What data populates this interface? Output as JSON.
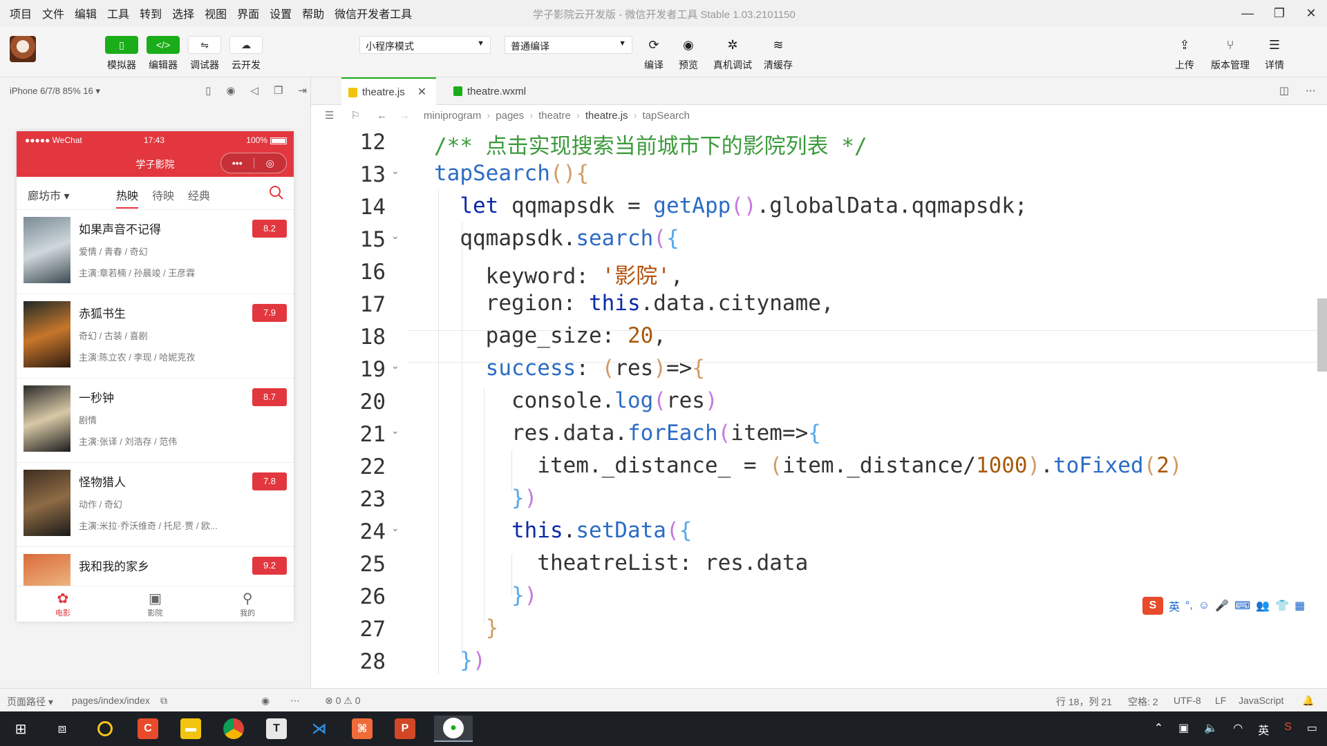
{
  "menu": [
    "项目",
    "文件",
    "编辑",
    "工具",
    "转到",
    "选择",
    "视图",
    "界面",
    "设置",
    "帮助",
    "微信开发者工具"
  ],
  "window_title": "学子影院云开发版 - 微信开发者工具 Stable 1.03.2101150",
  "toolbar": {
    "simulator": "模拟器",
    "editor": "编辑器",
    "debugger": "调试器",
    "cloud": "云开发",
    "mode_select": "小程序模式",
    "compile_select": "普通编译",
    "compile": "编译",
    "preview": "预览",
    "real_debug": "真机调试",
    "clear_cache": "清缓存",
    "upload": "上传",
    "version": "版本管理",
    "details": "详情"
  },
  "simulator": {
    "device": "iPhone 6/7/8 85% 16 ▾",
    "status_left": "●●●●● WeChat",
    "time": "17:43",
    "battery": "100%",
    "app_title": "学子影院",
    "city": "廊坊市",
    "tabs": [
      "热映",
      "待映",
      "经典"
    ],
    "movies": [
      {
        "name": "如果声音不记得",
        "tags": "爱情 / 青春 / 奇幻",
        "cast": "主演:章若楠 / 孙晨竣 / 王彦霖",
        "score": "8.2"
      },
      {
        "name": "赤狐书生",
        "tags": "奇幻 / 古装 / 喜剧",
        "cast": "主演:陈立农 / 李现 / 哈妮克孜",
        "score": "7.9"
      },
      {
        "name": "一秒钟",
        "tags": "剧情",
        "cast": "主演:张译 / 刘浩存 / 范伟",
        "score": "8.7"
      },
      {
        "name": "怪物猎人",
        "tags": "动作 / 奇幻",
        "cast": "主演:米拉·乔沃维奇 / 托尼·贾 / 欧...",
        "score": "7.8"
      },
      {
        "name": "我和我的家乡",
        "tags": "",
        "cast": "",
        "score": "9.2"
      }
    ],
    "tabbar": [
      "电影",
      "影院",
      "我的"
    ]
  },
  "editor": {
    "tabs": [
      "theatre.js",
      "theatre.wxml"
    ],
    "breadcrumb": [
      "miniprogram",
      "pages",
      "theatre",
      "theatre.js",
      "tapSearch"
    ],
    "line_numbers": [
      "12",
      "13",
      "14",
      "15",
      "16",
      "17",
      "18",
      "19",
      "20",
      "21",
      "22",
      "23",
      "24",
      "25",
      "26",
      "27",
      "28"
    ]
  },
  "statusbar": {
    "page_path_label": "页面路径 ▾",
    "page_path": "pages/index/index",
    "errors": "⊗ 0 ⚠ 0",
    "position": "行 18，列 21",
    "spaces": "空格: 2",
    "encoding": "UTF-8",
    "eol": "LF",
    "language": "JavaScript"
  },
  "ime": {
    "lang": "英"
  },
  "taskbar": {
    "tray_lang": "英"
  }
}
